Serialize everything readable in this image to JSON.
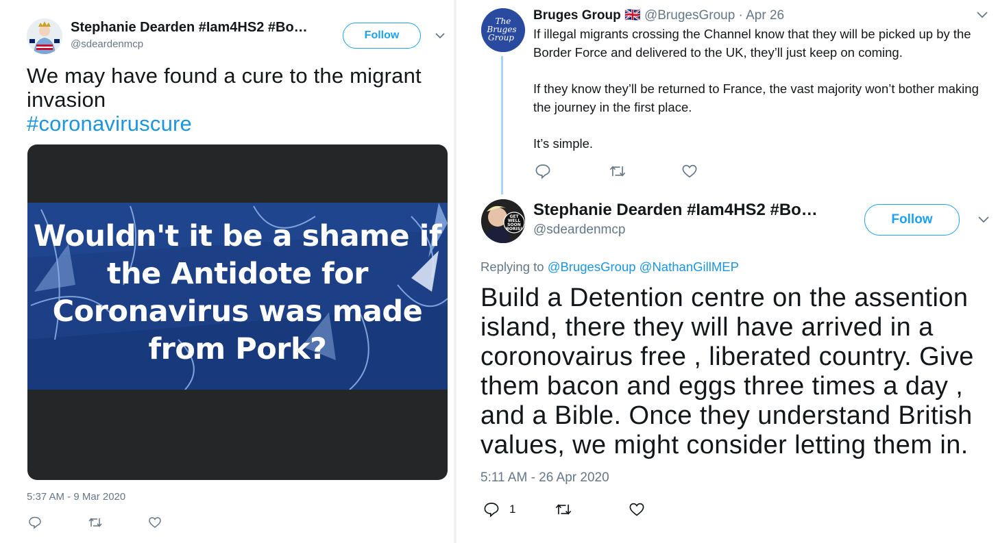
{
  "left_tweet": {
    "display_name": "Stephanie Dearden #Iam4HS2 #Bo…",
    "handle": "@sdeardenmcp",
    "follow_label": "Follow",
    "text": "We may have found a cure to the migrant invasion",
    "hashtag": "#coronaviruscure",
    "image_caption": "Wouldn't it be a shame if the Antidote for Coronavirus was made from Pork?",
    "timestamp": "5:37 AM - 9 Mar 2020",
    "icons": {
      "reply": "reply-icon",
      "retweet": "retweet-icon",
      "like": "heart-icon",
      "menu": "chevron-down-icon"
    },
    "colors": {
      "image_bg": "#1c3f86",
      "media_frame": "#252628"
    }
  },
  "right_thread": {
    "parent": {
      "display_name": "Bruges Group",
      "flag": "🇬🇧",
      "handle": "@BrugesGroup",
      "date": "· Apr 26",
      "avatar_text": [
        "The",
        "Bruges",
        "Group"
      ],
      "paragraphs": [
        "If illegal migrants crossing the Channel know that they will be picked up by the Border Force and delivered to the UK, they’ll just keep on coming.",
        "If they know they’ll be returned to France, the vast majority won’t bother making the journey in the first place.",
        "It’s simple."
      ]
    },
    "reply": {
      "display_name": "Stephanie Dearden #Iam4HS2 #Bo…",
      "handle": "@sdeardenmcp",
      "follow_label": "Follow",
      "avatar_text": [
        "GET",
        "WELL",
        "SOON",
        "BORIS!"
      ],
      "replying_prefix": "Replying to",
      "replying_to": [
        "@BrugesGroup",
        "@NathanGillMEP"
      ],
      "text": "Build a Detention centre on the assention island, there they will have arrived in a coronovairus free , liberated country. Give them bacon and eggs three times a day , and a Bible. Once they understand British values, we might consider letting them in.",
      "timestamp": "5:11 AM - 26 Apr 2020",
      "reply_count": "1"
    }
  },
  "colors": {
    "accent": "#1da1f2",
    "link": "#1b95e0",
    "muted": "#657786",
    "thread_line": "#a9d4f5"
  }
}
